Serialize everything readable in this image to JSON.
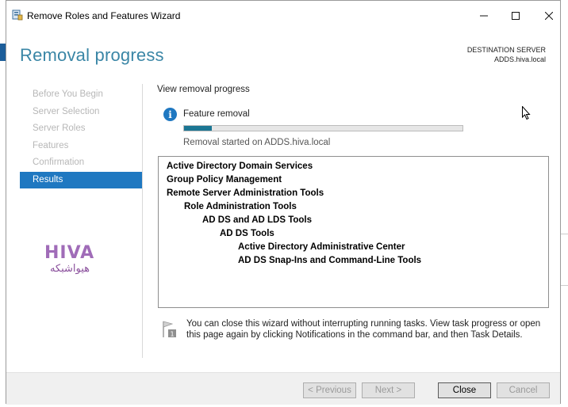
{
  "window": {
    "title": "Remove Roles and Features Wizard",
    "min_icon": "minimize-icon",
    "max_icon": "maximize-icon",
    "close_icon": "close-icon"
  },
  "header": {
    "title": "Removal progress",
    "dest_label": "DESTINATION SERVER",
    "dest_value": "ADDS.hiva.local"
  },
  "nav": {
    "items": [
      {
        "label": "Before You Begin",
        "active": false
      },
      {
        "label": "Server Selection",
        "active": false
      },
      {
        "label": "Server Roles",
        "active": false
      },
      {
        "label": "Features",
        "active": false
      },
      {
        "label": "Confirmation",
        "active": false
      },
      {
        "label": "Results",
        "active": true
      }
    ]
  },
  "logo": {
    "latin": "HIVA",
    "persian": "هیواشبکه"
  },
  "content": {
    "heading": "View removal progress",
    "status_title": "Feature removal",
    "progress": 0.1,
    "status_sub": "Removal started on ADDS.hiva.local",
    "features": [
      {
        "label": "Active Directory Domain Services",
        "level": 0
      },
      {
        "label": "Group Policy Management",
        "level": 0
      },
      {
        "label": "Remote Server Administration Tools",
        "level": 0
      },
      {
        "label": "Role Administration Tools",
        "level": 1
      },
      {
        "label": "AD DS and AD LDS Tools",
        "level": 2
      },
      {
        "label": "AD DS Tools",
        "level": 3
      },
      {
        "label": "Active Directory Administrative Center",
        "level": 4
      },
      {
        "label": "AD DS Snap-Ins and Command-Line Tools",
        "level": 4
      }
    ],
    "note": "You can close this wizard without interrupting running tasks. View task progress or open this page again by clicking Notifications in the command bar, and then Task Details."
  },
  "footer": {
    "prev_label": "< Previous",
    "next_label": "Next >",
    "close_label": "Close",
    "cancel_label": "Cancel"
  },
  "colors": {
    "accent": "#1f78c1",
    "title": "#3a86a6",
    "progress": "#1b7693"
  }
}
